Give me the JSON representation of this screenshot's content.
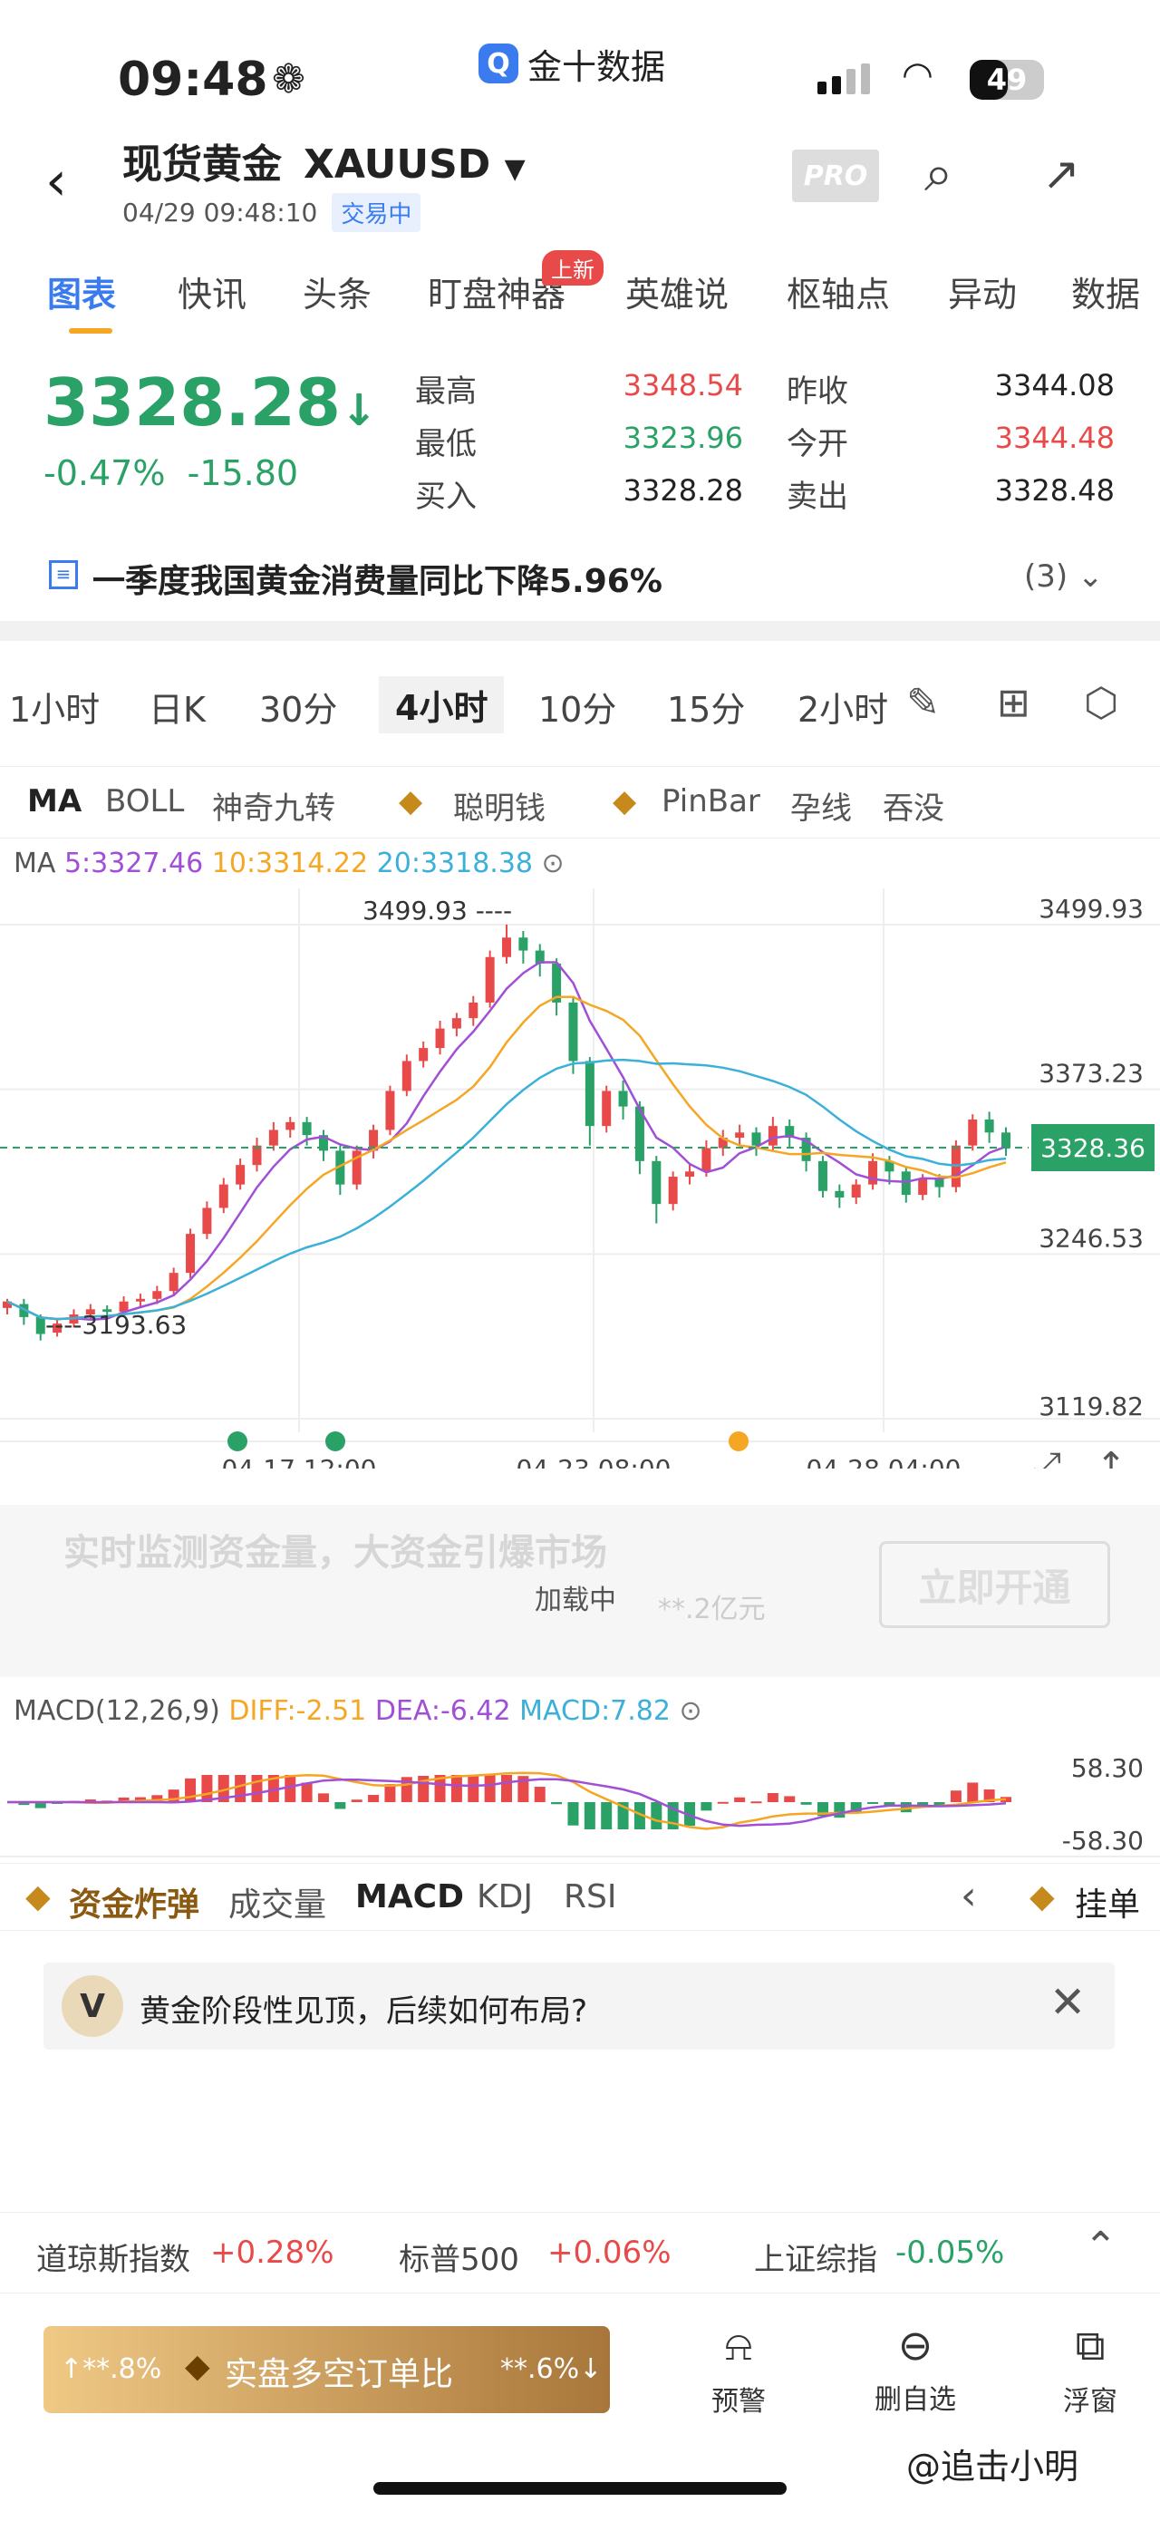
{
  "status": {
    "time": "09:48",
    "app_name": "金十数据",
    "battery": "49"
  },
  "header": {
    "name": "现货黄金",
    "code": "XAUUSD",
    "datetime": "04/29 09:48:10",
    "state": "交易中",
    "pro": "PRO"
  },
  "tabs": [
    {
      "label": "图表"
    },
    {
      "label": "快讯"
    },
    {
      "label": "头条"
    },
    {
      "label": "盯盘神器"
    },
    {
      "label": "英雄说"
    },
    {
      "label": "枢轴点"
    },
    {
      "label": "异动"
    },
    {
      "label": "数据"
    }
  ],
  "new_badge": "上新",
  "quote": {
    "price": "3328.28",
    "arrow": "↓",
    "change_pct": "-0.47%",
    "change": "-15.80",
    "high_label": "最高",
    "high": "3348.54",
    "low_label": "最低",
    "low": "3323.96",
    "bid_label": "买入",
    "bid": "3328.28",
    "prev_label": "昨收",
    "prev": "3344.08",
    "open_label": "今开",
    "open": "3344.48",
    "ask_label": "卖出",
    "ask": "3328.48"
  },
  "news": {
    "text": "一季度我国黄金消费量同比下降5.96%",
    "count": "(3)"
  },
  "periods": [
    "1小时",
    "日K",
    "30分",
    "4小时",
    "10分",
    "15分",
    "2小时"
  ],
  "indicators": [
    "MA",
    "BOLL",
    "神奇九转",
    "聪明钱",
    "PinBar",
    "孕线",
    "吞没"
  ],
  "ma": {
    "label": "MA",
    "ma5": "5:3327.46",
    "ma10": "10:3314.22",
    "ma20": "20:3318.38"
  },
  "chart_data": {
    "type": "candlestick",
    "y_ticks": [
      "3499.93",
      "3373.23",
      "3246.53",
      "3119.82"
    ],
    "ylim": [
      3119.82,
      3499.93
    ],
    "x_ticks": [
      "04-17 12:00",
      "04-23 08:00",
      "04-28 04:00"
    ],
    "high_label": "3499.93",
    "low_label": "3193.63",
    "current_label": "3328.36",
    "current": 3328.36,
    "candles": [
      [
        3205,
        3210,
        3200,
        3212
      ],
      [
        3208,
        3198,
        3192,
        3212
      ],
      [
        3198,
        3185,
        3180,
        3200
      ],
      [
        3186,
        3193,
        3183,
        3196
      ],
      [
        3193,
        3200,
        3190,
        3204
      ],
      [
        3200,
        3204,
        3196,
        3208
      ],
      [
        3204,
        3202,
        3198,
        3207
      ],
      [
        3202,
        3210,
        3199,
        3214
      ],
      [
        3210,
        3212,
        3206,
        3216
      ],
      [
        3212,
        3218,
        3208,
        3222
      ],
      [
        3218,
        3232,
        3214,
        3236
      ],
      [
        3232,
        3262,
        3228,
        3266
      ],
      [
        3262,
        3282,
        3258,
        3287
      ],
      [
        3282,
        3300,
        3278,
        3305
      ],
      [
        3300,
        3315,
        3296,
        3320
      ],
      [
        3315,
        3330,
        3310,
        3336
      ],
      [
        3330,
        3342,
        3326,
        3348
      ],
      [
        3342,
        3348,
        3336,
        3352
      ],
      [
        3348,
        3338,
        3330,
        3352
      ],
      [
        3338,
        3326,
        3318,
        3342
      ],
      [
        3326,
        3300,
        3292,
        3330
      ],
      [
        3300,
        3326,
        3296,
        3330
      ],
      [
        3326,
        3342,
        3320,
        3346
      ],
      [
        3342,
        3372,
        3338,
        3376
      ],
      [
        3372,
        3395,
        3368,
        3400
      ],
      [
        3395,
        3405,
        3390,
        3410
      ],
      [
        3405,
        3420,
        3400,
        3426
      ],
      [
        3420,
        3428,
        3414,
        3432
      ],
      [
        3428,
        3440,
        3422,
        3445
      ],
      [
        3440,
        3475,
        3436,
        3480
      ],
      [
        3475,
        3490,
        3470,
        3500
      ],
      [
        3490,
        3480,
        3470,
        3495
      ],
      [
        3480,
        3470,
        3460,
        3485
      ],
      [
        3470,
        3440,
        3430,
        3474
      ],
      [
        3440,
        3395,
        3385,
        3445
      ],
      [
        3395,
        3345,
        3330,
        3398
      ],
      [
        3345,
        3372,
        3340,
        3376
      ],
      [
        3372,
        3360,
        3350,
        3380
      ],
      [
        3360,
        3318,
        3308,
        3364
      ],
      [
        3318,
        3285,
        3270,
        3322
      ],
      [
        3285,
        3306,
        3280,
        3310
      ],
      [
        3306,
        3310,
        3300,
        3316
      ],
      [
        3310,
        3328,
        3306,
        3334
      ],
      [
        3328,
        3336,
        3322,
        3342
      ],
      [
        3336,
        3340,
        3330,
        3346
      ],
      [
        3340,
        3330,
        3322,
        3344
      ],
      [
        3330,
        3345,
        3326,
        3352
      ],
      [
        3345,
        3336,
        3328,
        3350
      ],
      [
        3336,
        3318,
        3310,
        3340
      ],
      [
        3318,
        3295,
        3290,
        3322
      ],
      [
        3295,
        3290,
        3282,
        3300
      ],
      [
        3290,
        3300,
        3285,
        3304
      ],
      [
        3300,
        3318,
        3296,
        3324
      ],
      [
        3318,
        3310,
        3300,
        3322
      ],
      [
        3310,
        3292,
        3286,
        3314
      ],
      [
        3292,
        3304,
        3288,
        3308
      ],
      [
        3304,
        3298,
        3290,
        3308
      ],
      [
        3298,
        3330,
        3294,
        3334
      ],
      [
        3330,
        3350,
        3326,
        3354
      ],
      [
        3350,
        3340,
        3332,
        3356
      ],
      [
        3340,
        3328,
        3322,
        3344
      ]
    ]
  },
  "promo": {
    "text": "实时监测资金量，大资金引爆市场",
    "loading": "加载中",
    "amount": "**.2亿元",
    "button": "立即开通"
  },
  "macd": {
    "label": "MACD(12,26,9)",
    "diff": "DIFF:-2.51",
    "dea": "DEA:-6.42",
    "macd": "MACD:7.82",
    "top": "58.30",
    "bottom": "-58.30"
  },
  "bottom_tabs": [
    "资金炸弹",
    "成交量",
    "MACD",
    "KDJ",
    "RSI",
    "挂单"
  ],
  "ask": {
    "question": "黄金阶段性见顶，后续如何布局?"
  },
  "ticker": [
    {
      "name": "道琼斯指数",
      "value": "+0.28%"
    },
    {
      "name": "标普500",
      "value": "+0.06%"
    },
    {
      "name": "上证综指",
      "value": "-0.05%"
    }
  ],
  "bottom": {
    "left_pct": "↑**.8%",
    "button": "实盘多空订单比",
    "right_pct": "**.6%↓",
    "alert": "预警",
    "remove": "删自选",
    "float": "浮窗"
  },
  "watermark": "@追击小明",
  "colors": {
    "up": "#e84a4a",
    "down": "#2aa166",
    "accent": "#3a7bf0",
    "ma5": "#a04fd6",
    "ma10": "#f5a623",
    "ma20": "#3bb0d8"
  }
}
